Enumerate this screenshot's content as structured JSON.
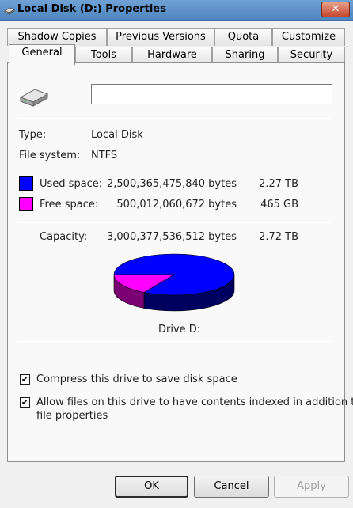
{
  "window": {
    "title": "Local Disk (D:) Properties",
    "close_label": "✕"
  },
  "tabs_top": [
    "Shadow Copies",
    "Previous Versions",
    "Quota",
    "Customize"
  ],
  "tabs_bottom": [
    "General",
    "Tools",
    "Hardware",
    "Sharing",
    "Security"
  ],
  "active_tab": "General",
  "general": {
    "drive_name_value": "",
    "drive_icon": "hard-drive-icon",
    "type_label": "Type:",
    "type_value": "Local Disk",
    "fs_label": "File system:",
    "fs_value": "NTFS",
    "used_label": "Used space:",
    "used_bytes": "2,500,365,475,840 bytes",
    "used_size": "2.27 TB",
    "used_color": "#0000ff",
    "free_label": "Free space:",
    "free_bytes": "500,012,060,672 bytes",
    "free_size": "465 GB",
    "free_color": "#ff00ff",
    "capacity_label": "Capacity:",
    "capacity_bytes": "3,000,377,536,512 bytes",
    "capacity_size": "2.72 TB",
    "drive_label": "Drive D:",
    "compress_label": "Compress this drive to save disk space",
    "compress_checked": true,
    "index_label_line1": "Allow files on this drive to have contents indexed in addition to",
    "index_label_line2": "file properties",
    "index_checked": true
  },
  "chart_data": {
    "type": "pie",
    "categories": [
      "Used space",
      "Free space"
    ],
    "values": [
      2500365475840,
      500012060672
    ],
    "colors": [
      "#0000ff",
      "#ff00ff"
    ],
    "title": "Drive D:"
  },
  "buttons": {
    "ok": "OK",
    "cancel": "Cancel",
    "apply": "Apply"
  }
}
